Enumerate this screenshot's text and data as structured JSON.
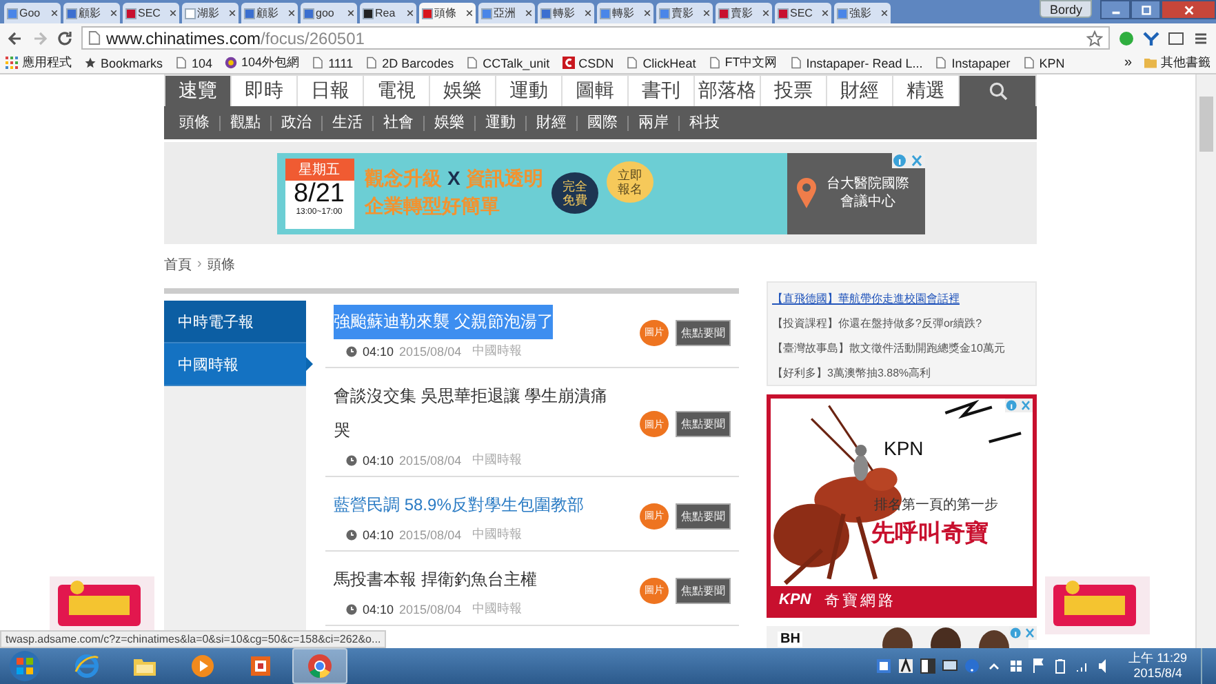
{
  "tabs": [
    {
      "label": "Goo",
      "kind": "google",
      "selected": false
    },
    {
      "label": "顧影",
      "kind": "doc",
      "selected": false
    },
    {
      "label": "SEC",
      "kind": "sec",
      "selected": false
    },
    {
      "label": "湖影",
      "kind": "gmail",
      "selected": false
    },
    {
      "label": "顧影",
      "kind": "doc",
      "selected": false
    },
    {
      "label": "goo",
      "kind": "doc",
      "selected": false
    },
    {
      "label": "Rea",
      "kind": "text",
      "selected": false
    },
    {
      "label": "頭條",
      "kind": "ct",
      "selected": true
    },
    {
      "label": "亞洲",
      "kind": "google",
      "selected": false
    },
    {
      "label": "轉影",
      "kind": "doc",
      "selected": false
    },
    {
      "label": "轉影",
      "kind": "google",
      "selected": false
    },
    {
      "label": "賣影",
      "kind": "google",
      "selected": false
    },
    {
      "label": "賣影",
      "kind": "sec",
      "selected": false
    },
    {
      "label": "SEC",
      "kind": "sec",
      "selected": false
    },
    {
      "label": "強影",
      "kind": "google",
      "selected": false
    }
  ],
  "browser": {
    "user": "Bordy",
    "url_domain": "www.chinatimes.com",
    "url_path": "/focus/260501"
  },
  "bookmarks": [
    {
      "label": "應用程式",
      "kind": "apps"
    },
    {
      "label": "Bookmarks",
      "kind": "star"
    },
    {
      "label": "104",
      "kind": "page"
    },
    {
      "label": "104外包網",
      "kind": "logo"
    },
    {
      "label": "1111",
      "kind": "page"
    },
    {
      "label": "2D Barcodes",
      "kind": "page"
    },
    {
      "label": "CCTalk_unit",
      "kind": "page"
    },
    {
      "label": "CSDN",
      "kind": "csdn"
    },
    {
      "label": "ClickHeat",
      "kind": "page"
    },
    {
      "label": "FT中文网",
      "kind": "page"
    },
    {
      "label": "Instapaper- Read L...",
      "kind": "page"
    },
    {
      "label": "Instapaper",
      "kind": "page"
    },
    {
      "label": "KPN",
      "kind": "page"
    }
  ],
  "bookmarks_more": "»",
  "other_bookmarks": "其他書籤",
  "nav": [
    {
      "label": "速覽",
      "selected": true
    },
    {
      "label": "即時",
      "selected": false
    },
    {
      "label": "日報",
      "selected": false
    },
    {
      "label": "電視",
      "selected": false
    },
    {
      "label": "娛樂",
      "selected": false
    },
    {
      "label": "運動",
      "selected": false
    },
    {
      "label": "圖輯",
      "selected": false
    },
    {
      "label": "書刊",
      "selected": false
    },
    {
      "label": "部落格",
      "selected": false
    },
    {
      "label": "投票",
      "selected": false
    },
    {
      "label": "財經",
      "selected": false
    },
    {
      "label": "精選",
      "selected": false
    }
  ],
  "subnav": [
    "頭條",
    "觀點",
    "政治",
    "生活",
    "社會",
    "娛樂",
    "運動",
    "財經",
    "國際",
    "兩岸",
    "科技"
  ],
  "banner": {
    "day": "星期五",
    "date": "8/21",
    "time": "13:00~17:00",
    "slogan_a": "觀念升級",
    "slogan_x": "X",
    "slogan_b": "資訊透明",
    "slogan_2": "企業轉型好簡單",
    "bubble_free": "完全免費",
    "bubble_signup": "立即報名",
    "venue": "台大醫院國際會議中心"
  },
  "breadcrumb": {
    "home": "首頁",
    "separator": "›",
    "current": "頭條"
  },
  "sidebar": [
    {
      "label": "中時電子報",
      "selected": false
    },
    {
      "label": "中國時報",
      "selected": true
    }
  ],
  "articles": [
    {
      "title": "強颱蘇迪勒來襲 父親節泡湯了",
      "text_selected": true,
      "hovered": false,
      "time": "04:10",
      "date": "2015/08/04",
      "source": "中國時報",
      "badge": "圖片",
      "tag": "焦點要聞"
    },
    {
      "title": "會談沒交集 吳思華拒退讓 學生崩潰痛哭",
      "text_selected": false,
      "hovered": false,
      "time": "04:10",
      "date": "2015/08/04",
      "source": "中國時報",
      "badge": "圖片",
      "tag": "焦點要聞"
    },
    {
      "title": "藍營民調 58.9%反對學生包圍教部",
      "text_selected": false,
      "hovered": true,
      "time": "04:10",
      "date": "2015/08/04",
      "source": "中國時報",
      "badge": "圖片",
      "tag": "焦點要聞"
    },
    {
      "title": "馬投書本報 捍衛釣魚台主權",
      "text_selected": false,
      "hovered": false,
      "time": "04:10",
      "date": "2015/08/04",
      "source": "中國時報",
      "badge": "圖片",
      "tag": "焦點要聞"
    }
  ],
  "promo_links": [
    {
      "text": "【直飛德國】華航帶你走進校園會話裡",
      "hovered": true
    },
    {
      "text": "【投資課程】你還在盤持做多?反彈or續跌?",
      "hovered": false
    },
    {
      "text": "【臺灣故事島】散文徵件活動開跑總獎金10萬元",
      "hovered": false
    },
    {
      "text": "【好利多】3萬澳幣抽3.88%高利",
      "hovered": false
    }
  ],
  "kpn_ad": {
    "logo": "KPN",
    "tagline": "排名第一頁的第一步",
    "headline": "先呼叫奇寶",
    "footer_logo": "KPN",
    "footer_name": "奇寶網路"
  },
  "bh_ad": {
    "logo": "BH"
  },
  "status_url": "twasp.adsame.com/c?z=chinatimes&la=0&si=10&cg=50&c=158&ci=262&o...",
  "taskbar": {
    "apps": [
      {
        "kind": "ie",
        "selected": false
      },
      {
        "kind": "folder",
        "selected": false
      },
      {
        "kind": "media",
        "selected": false
      },
      {
        "kind": "office",
        "selected": false
      },
      {
        "kind": "chrome",
        "selected": true
      }
    ],
    "time": "上午 11:29",
    "date": "2015/8/4"
  }
}
